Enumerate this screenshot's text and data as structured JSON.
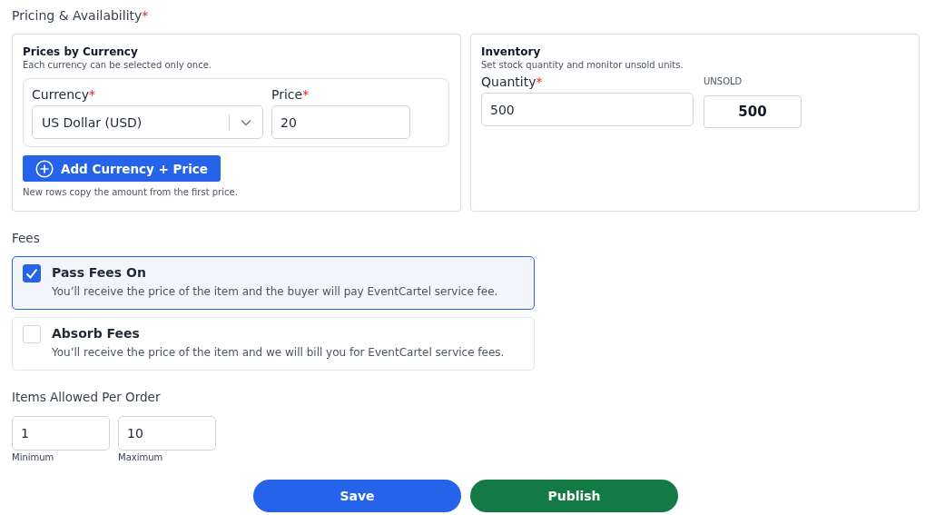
{
  "section": {
    "title": "Pricing & Availability",
    "required_mark": "*"
  },
  "prices_card": {
    "title": "Prices by Currency",
    "subtitle": "Each currency can be selected only once.",
    "rows": [
      {
        "currency_label": "Currency",
        "currency_required": "*",
        "currency_value": "US Dollar (USD)",
        "price_label": "Price",
        "price_required": "*",
        "price_value": "20"
      }
    ],
    "add_button": "Add Currency + Price",
    "note": "New rows copy the amount from the first price."
  },
  "inventory_card": {
    "title": "Inventory",
    "subtitle": "Set stock quantity and monitor unsold units.",
    "quantity_label": "Quantity",
    "quantity_required": "*",
    "quantity_value": "500",
    "unsold_label": "UNSOLD",
    "unsold_value": "500"
  },
  "fees": {
    "label": "Fees",
    "options": [
      {
        "title": "Pass Fees On",
        "description": "You’ll receive the price of the item and the buyer will pay EventCartel service fee.",
        "checked": true
      },
      {
        "title": "Absorb Fees",
        "description": "You’ll receive the price of the item and we will bill you for EventCartel service fees.",
        "checked": false
      }
    ]
  },
  "items_per_order": {
    "label": "Items Allowed Per Order",
    "fields": [
      {
        "value": "1",
        "caption": "Minimum"
      },
      {
        "value": "10",
        "caption": "Maximum"
      }
    ]
  },
  "buttons": [
    {
      "label": "Save",
      "kind": "save"
    },
    {
      "label": "Publish",
      "kind": "publish"
    }
  ]
}
